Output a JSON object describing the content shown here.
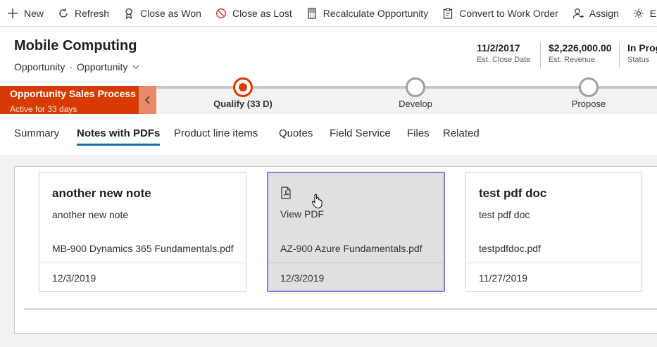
{
  "command_bar": {
    "items": [
      {
        "label": "New",
        "icon": "plus-icon"
      },
      {
        "label": "Refresh",
        "icon": "refresh-icon"
      },
      {
        "label": "Close as Won",
        "icon": "ribbon-icon"
      },
      {
        "label": "Close as Lost",
        "icon": "prohibited-icon"
      },
      {
        "label": "Recalculate Opportunity",
        "icon": "calculator-icon"
      },
      {
        "label": "Convert to Work Order",
        "icon": "clipboard-icon"
      },
      {
        "label": "Assign",
        "icon": "person-icon"
      },
      {
        "label": "En",
        "icon": "gear-icon"
      }
    ]
  },
  "header": {
    "title": "Mobile Computing",
    "entity": "Opportunity",
    "form": "Opportunity",
    "fields": [
      {
        "value": "11/2/2017",
        "label": "Est. Close Date"
      },
      {
        "value": "$2,226,000.00",
        "label": "Est. Revenue"
      },
      {
        "value": "In Prog",
        "label": "Status"
      }
    ]
  },
  "bpf": {
    "name": "Opportunity Sales Process",
    "status": "Active for 33 days",
    "stages": [
      {
        "label": "Qualify  (33 D)",
        "active": true
      },
      {
        "label": "Develop",
        "active": false
      },
      {
        "label": "Propose",
        "active": false
      }
    ]
  },
  "tabs": [
    {
      "label": "Summary",
      "active": false
    },
    {
      "label": "Notes with PDFs",
      "active": true
    },
    {
      "label": "Product line items",
      "active": false
    },
    {
      "label": "Quotes",
      "active": false
    },
    {
      "label": "Field Service",
      "active": false
    },
    {
      "label": "Files",
      "active": false
    },
    {
      "label": "Related",
      "active": false
    }
  ],
  "cards": [
    {
      "title": "another new note",
      "subtitle": "another new note",
      "file": "MB-900 Dynamics 365 Fundamentals.pdf",
      "date": "12/3/2019",
      "selected": false
    },
    {
      "title": "",
      "subtitle": "View PDF",
      "file": "AZ-900 Azure Fundamentals.pdf",
      "date": "12/3/2019",
      "selected": true,
      "icon": "pdf-icon"
    },
    {
      "title": "test pdf doc",
      "subtitle": "test pdf doc",
      "file": "testpdfdoc.pdf",
      "date": "11/27/2019",
      "selected": false
    }
  ],
  "colors": {
    "bpf_accent": "#d83b01",
    "tab_underline": "#0f6cbd",
    "selected_border": "#6e8ae0"
  }
}
